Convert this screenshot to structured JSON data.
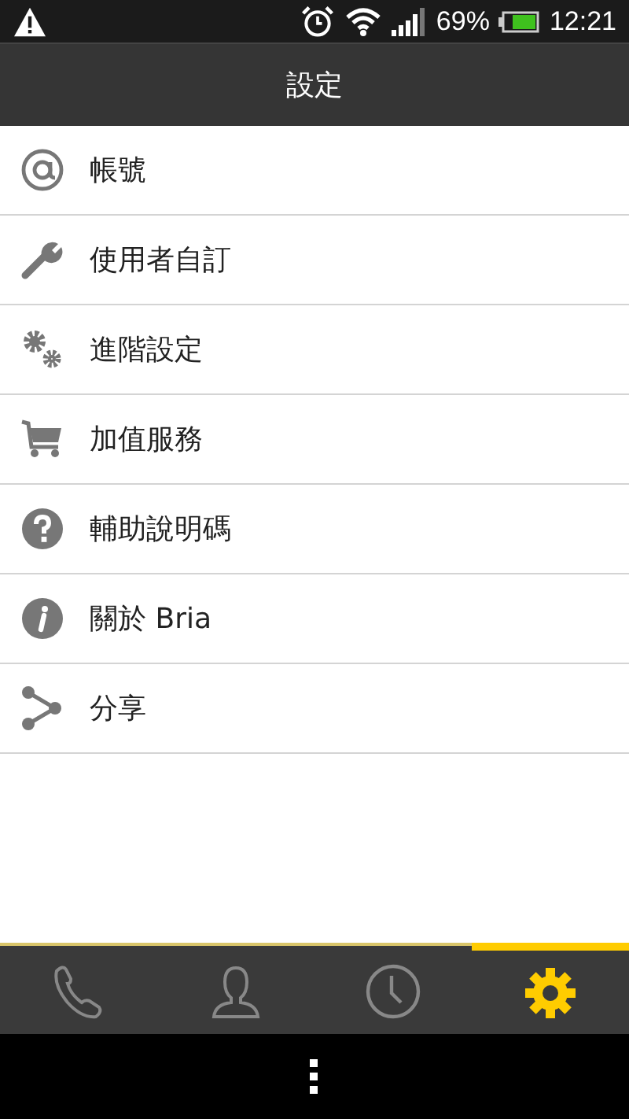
{
  "status_bar": {
    "battery": "69%",
    "time": "12:21"
  },
  "title": "設定",
  "items": [
    {
      "kind": "at",
      "label": "帳號"
    },
    {
      "kind": "wrench",
      "label": "使用者自訂"
    },
    {
      "kind": "gears",
      "label": "進階設定"
    },
    {
      "kind": "cart",
      "label": "加值服務"
    },
    {
      "kind": "help",
      "label": "輔助說明碼"
    },
    {
      "kind": "info",
      "label": "關於 Bria"
    },
    {
      "kind": "share",
      "label": "分享"
    }
  ],
  "tabs": [
    {
      "kind": "phone",
      "selected": false
    },
    {
      "kind": "contacts",
      "selected": false
    },
    {
      "kind": "history",
      "selected": false
    },
    {
      "kind": "settings",
      "selected": true
    }
  ]
}
